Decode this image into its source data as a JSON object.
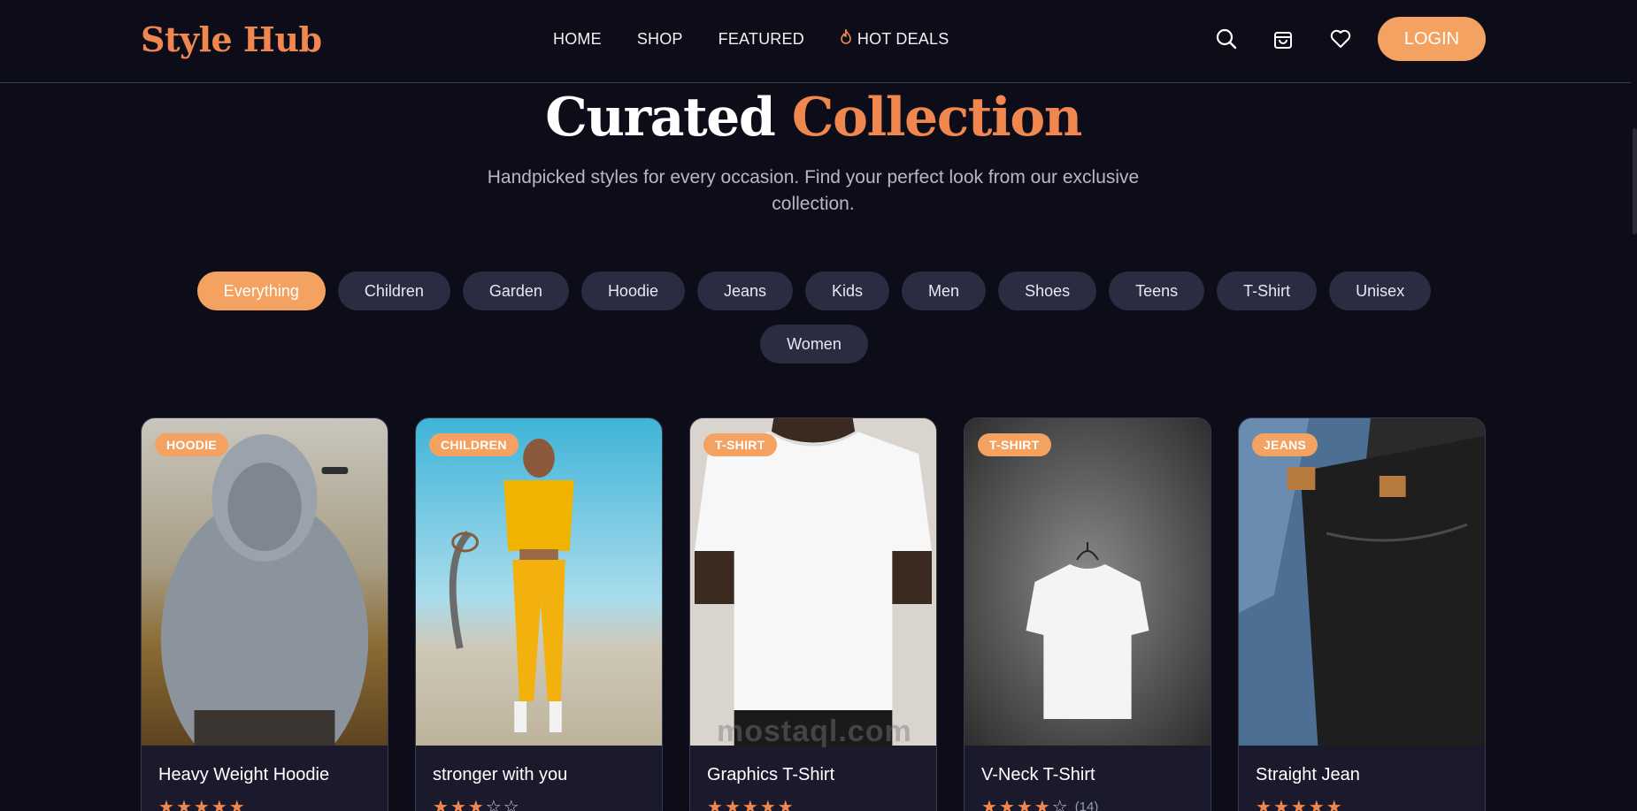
{
  "brand": {
    "logo": "Style Hub",
    "accent_color": "#f0874f",
    "button_color": "#f4a261",
    "background": "#0d0d1a"
  },
  "nav": {
    "links": [
      {
        "label": "HOME",
        "icon": null
      },
      {
        "label": "SHOP",
        "icon": null
      },
      {
        "label": "FEATURED",
        "icon": null
      },
      {
        "label": "HOT DEALS",
        "icon": "flame-icon"
      }
    ],
    "icons": [
      "search-icon",
      "shopping-bag-icon",
      "heart-icon"
    ],
    "login_label": "LOGIN"
  },
  "hero": {
    "title_part1": "Curated",
    "title_part2": "Collection",
    "subtitle": "Handpicked styles for every occasion. Find your perfect look from our exclusive collection."
  },
  "filters": {
    "selected": "Everything",
    "options": [
      "Everything",
      "Children",
      "Garden",
      "Hoodie",
      "Jeans",
      "Kids",
      "Men",
      "Shoes",
      "Teens",
      "T-Shirt",
      "Unisex",
      "Women"
    ]
  },
  "products": [
    {
      "badge": "HOODIE",
      "title": "Heavy Weight Hoodie",
      "rating": 5,
      "reviews": ""
    },
    {
      "badge": "CHILDREN",
      "title": "stronger with you",
      "rating": 3,
      "reviews": ""
    },
    {
      "badge": "T-SHIRT",
      "title": "Graphics T-Shirt",
      "rating": 5,
      "reviews": ""
    },
    {
      "badge": "T-SHIRT",
      "title": "V-Neck T-Shirt",
      "rating": 4,
      "reviews": "(14)"
    },
    {
      "badge": "JEANS",
      "title": "Straight Jean",
      "rating": 5,
      "reviews": ""
    }
  ],
  "watermark": "mostaql.com"
}
